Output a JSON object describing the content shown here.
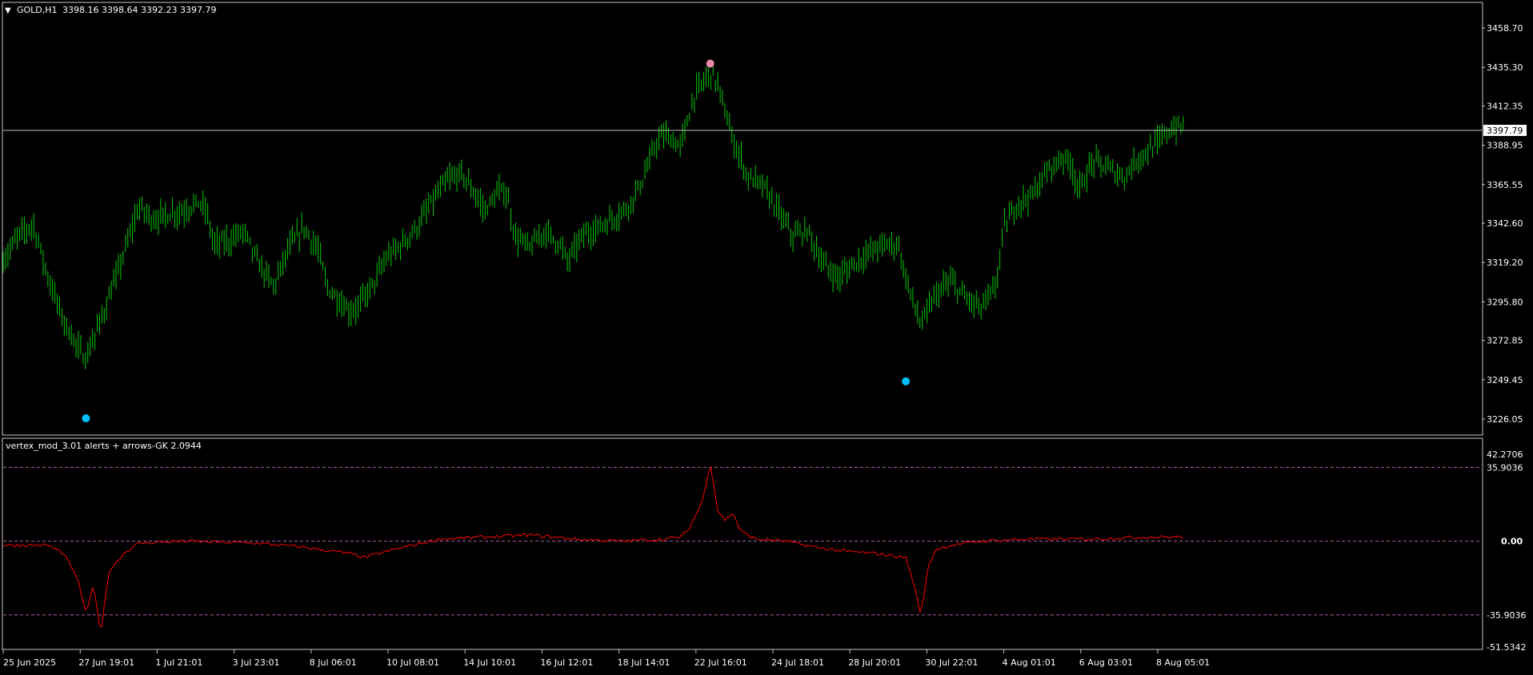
{
  "symbol_header": {
    "arrow": "▼",
    "symbol": "GOLD,H1",
    "ohlc": "3398.16 3398.64 3392.23 3397.79"
  },
  "indicator_header": "vertex_mod_3.01 alerts + arrows-GK 2.0944",
  "colors": {
    "background": "#000000",
    "candles": "#00cc00",
    "indicator_line": "#ff0000",
    "level_lines": "#b060b0",
    "signal_top": "#e88aa8",
    "signal_bottom": "#00bfff",
    "axis_text": "#ffffff",
    "current_price_line": "#c0c0c0"
  },
  "chart_data": [
    {
      "type": "candlestick",
      "title": "GOLD,H1",
      "y_ticks": [
        "3458.70",
        "3435.30",
        "3412.35",
        "3388.95",
        "3365.55",
        "3342.60",
        "3319.20",
        "3295.80",
        "3272.85",
        "3249.45",
        "3226.05"
      ],
      "ylim": [
        3226.05,
        3458.7
      ],
      "current_price": "3397.79",
      "x_ticks": [
        "25 Jun 2025",
        "27 Jun 19:01",
        "1 Jul 21:01",
        "3 Jul 23:01",
        "8 Jul 06:01",
        "10 Jul 08:01",
        "14 Jul 10:01",
        "16 Jul 12:01",
        "18 Jul 14:01",
        "22 Jul 16:01",
        "24 Jul 18:01",
        "28 Jul 20:01",
        "30 Jul 22:01",
        "4 Aug 01:01",
        "6 Aug 03:01",
        "8 Aug 05:01"
      ],
      "price_path": [
        [
          0,
          3320
        ],
        [
          2,
          3335
        ],
        [
          4,
          3342
        ],
        [
          6,
          3310
        ],
        [
          8,
          3285
        ],
        [
          10,
          3268
        ],
        [
          11,
          3262
        ],
        [
          13,
          3285
        ],
        [
          15,
          3310
        ],
        [
          17,
          3338
        ],
        [
          18,
          3352
        ],
        [
          20,
          3345
        ],
        [
          22,
          3348
        ],
        [
          24,
          3350
        ],
        [
          26,
          3355
        ],
        [
          27,
          3350
        ],
        [
          28,
          3330
        ],
        [
          30,
          3332
        ],
        [
          32,
          3338
        ],
        [
          34,
          3318
        ],
        [
          36,
          3305
        ],
        [
          38,
          3328
        ],
        [
          40,
          3340
        ],
        [
          42,
          3325
        ],
        [
          43,
          3305
        ],
        [
          44,
          3300
        ],
        [
          46,
          3290
        ],
        [
          47,
          3292
        ],
        [
          49,
          3305
        ],
        [
          51,
          3322
        ],
        [
          53,
          3330
        ],
        [
          55,
          3340
        ],
        [
          57,
          3355
        ],
        [
          59,
          3368
        ],
        [
          61,
          3372
        ],
        [
          63,
          3358
        ],
        [
          64,
          3350
        ],
        [
          66,
          3362
        ],
        [
          67,
          3360
        ],
        [
          68,
          3335
        ],
        [
          70,
          3328
        ],
        [
          72,
          3338
        ],
        [
          74,
          3330
        ],
        [
          75,
          3320
        ],
        [
          77,
          3335
        ],
        [
          79,
          3340
        ],
        [
          81,
          3345
        ],
        [
          83,
          3352
        ],
        [
          85,
          3368
        ],
        [
          87,
          3392
        ],
        [
          88,
          3395
        ],
        [
          90,
          3388
        ],
        [
          92,
          3420
        ],
        [
          94,
          3432
        ],
        [
          95,
          3425
        ],
        [
          97,
          3392
        ],
        [
          98,
          3382
        ],
        [
          99,
          3370
        ],
        [
          101,
          3365
        ],
        [
          103,
          3350
        ],
        [
          105,
          3335
        ],
        [
          107,
          3338
        ],
        [
          109,
          3318
        ],
        [
          111,
          3310
        ],
        [
          113,
          3318
        ],
        [
          115,
          3325
        ],
        [
          117,
          3330
        ],
        [
          119,
          3330
        ],
        [
          120,
          3310
        ],
        [
          122,
          3282
        ],
        [
          124,
          3300
        ],
        [
          126,
          3308
        ],
        [
          128,
          3298
        ],
        [
          130,
          3292
        ],
        [
          132,
          3305
        ],
        [
          133,
          3340
        ],
        [
          135,
          3355
        ],
        [
          137,
          3360
        ],
        [
          139,
          3375
        ],
        [
          141,
          3382
        ],
        [
          142,
          3378
        ],
        [
          143,
          3362
        ],
        [
          145,
          3380
        ],
        [
          147,
          3375
        ],
        [
          149,
          3370
        ],
        [
          151,
          3382
        ],
        [
          153,
          3388
        ],
        [
          155,
          3398
        ],
        [
          157,
          3400
        ]
      ],
      "signals": [
        {
          "kind": "top",
          "label": "high",
          "value": 3437.5,
          "x": 94
        },
        {
          "kind": "bottom",
          "label": "low",
          "value": 3226.5,
          "x": 11
        },
        {
          "kind": "bottom",
          "label": "low",
          "value": 3248.5,
          "x": 120
        }
      ]
    },
    {
      "type": "line",
      "title": "vertex_mod_3.01 alerts + arrows-GK 2.0944",
      "ylim": [
        -51.5342,
        42.2706
      ],
      "y_ticks": [
        "42.2706",
        "35.9036",
        "0.00",
        "-35.9036",
        "-51.5342"
      ],
      "levels": [
        35.9036,
        0,
        -35.9036
      ],
      "series": [
        {
          "values_x": [
            0,
            6,
            8,
            9,
            10,
            11,
            12,
            13,
            14,
            16,
            18,
            24,
            34,
            40,
            46,
            48,
            52,
            58,
            64,
            70,
            76,
            82,
            88,
            90,
            91,
            92,
            93,
            94,
            95,
            96,
            97,
            98,
            100,
            104,
            108,
            112,
            116,
            120,
            121,
            122,
            123,
            124,
            126,
            130,
            136,
            144,
            152,
            157
          ],
          "values_y": [
            -2,
            -2,
            -6,
            -12,
            -20,
            -35,
            -22,
            -45,
            -15,
            -6,
            -1,
            0,
            -1,
            -3,
            -6,
            -8,
            -4,
            1,
            2,
            3,
            1,
            0,
            1,
            2,
            5,
            12,
            20,
            38,
            15,
            10,
            14,
            5,
            1,
            0,
            -3,
            -5,
            -6,
            -8,
            -20,
            -36,
            -12,
            -4,
            -2,
            0,
            1,
            1,
            2,
            2
          ]
        }
      ]
    }
  ]
}
